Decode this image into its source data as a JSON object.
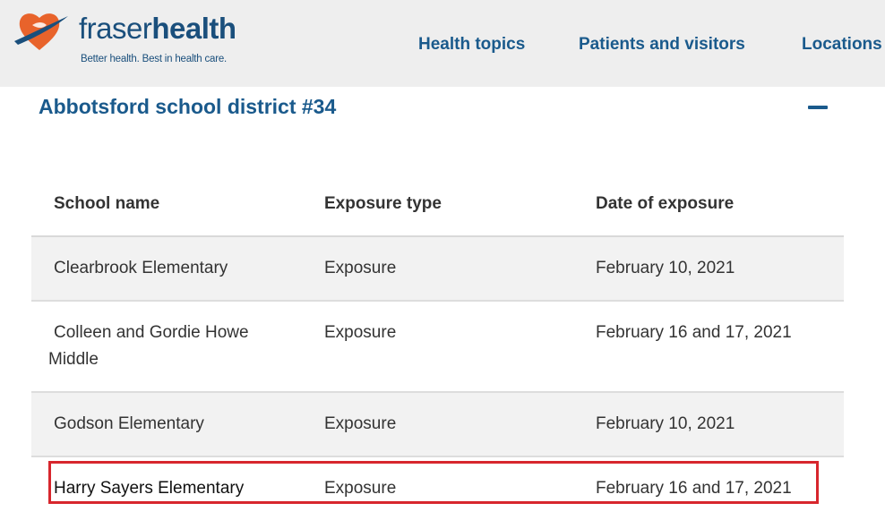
{
  "header": {
    "logo": {
      "word_light": "fraser",
      "word_bold": "health",
      "tagline": "Better health. Best in health care."
    },
    "nav": [
      {
        "label": "Health topics"
      },
      {
        "label": "Patients and visitors"
      },
      {
        "label": "Locations"
      }
    ]
  },
  "accordion": {
    "title": "Abbotsford school district #34",
    "toggle_icon": "minus-icon",
    "expanded": true
  },
  "table": {
    "headers": [
      "School name",
      "Exposure type",
      "Date of exposure"
    ],
    "rows": [
      {
        "school": "Clearbrook Elementary",
        "type": "Exposure",
        "date": "February 10, 2021"
      },
      {
        "school": "Colleen and Gordie Howe Middle",
        "type": "Exposure",
        "date": "February 16 and 17, 2021"
      },
      {
        "school": "Godson Elementary",
        "type": "Exposure",
        "date": "February 10, 2021"
      },
      {
        "school": "Harry Sayers Elementary",
        "type": "Exposure",
        "date": "February 16 and 17, 2021"
      }
    ],
    "highlighted_row_index": 3
  },
  "colors": {
    "brand_blue": "#1a5a8c",
    "brand_orange": "#e8632b",
    "header_bg": "#eeeeee",
    "highlight_red": "#d7262d",
    "row_shade": "#f2f2f2"
  }
}
